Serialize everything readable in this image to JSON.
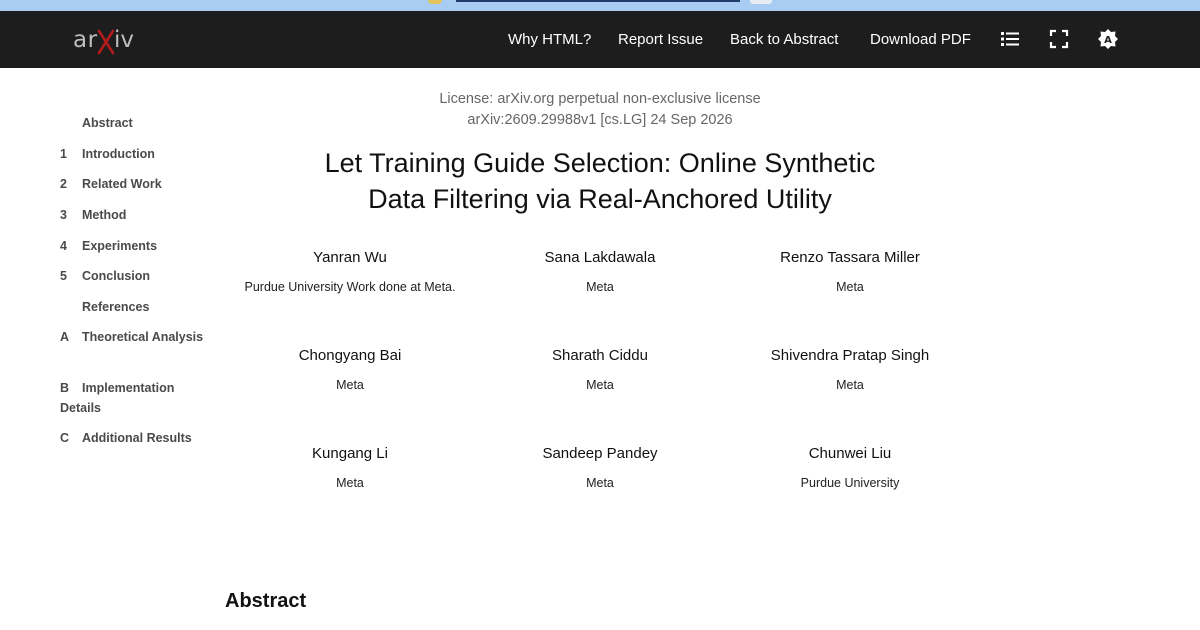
{
  "header": {
    "logo": "arXiv",
    "nav": [
      "Why HTML?",
      "Report Issue",
      "Back to Abstract",
      "Download PDF"
    ],
    "icons": [
      "list-icon",
      "fullscreen-icon",
      "theme-icon"
    ],
    "background_color": "#1d1d1d"
  },
  "toc": {
    "items": [
      {
        "num": "",
        "label": "Abstract"
      },
      {
        "num": "1",
        "label": "Introduction"
      },
      {
        "num": "2",
        "label": "Related Work"
      },
      {
        "num": "3",
        "label": "Method"
      },
      {
        "num": "4",
        "label": "Experiments"
      },
      {
        "num": "5",
        "label": "Conclusion"
      },
      {
        "num": "",
        "label": "References"
      },
      {
        "num": "A",
        "label": "Theoretical Analysis"
      },
      {
        "num": "B",
        "label": "Implementation Details"
      },
      {
        "num": "C",
        "label": "Additional Results"
      }
    ]
  },
  "paper": {
    "license": "License: arXiv.org perpetual non-exclusive license",
    "identifier": "arXiv:2609.29988v1 [cs.LG] 24 Sep 2026",
    "title_line1": "Let Training Guide Selection: Online Synthetic",
    "title_line2": "Data Filtering via Real-Anchored Utility",
    "authors": [
      {
        "name": "Yanran Wu",
        "affiliation": "Purdue University Work done at Meta."
      },
      {
        "name": "Sana Lakdawala",
        "affiliation": "Meta"
      },
      {
        "name": "Renzo Tassara Miller",
        "affiliation": "Meta"
      },
      {
        "name": "Chongyang Bai",
        "affiliation": "Meta"
      },
      {
        "name": "Sharath Ciddu",
        "affiliation": "Meta"
      },
      {
        "name": "Shivendra Pratap Singh",
        "affiliation": "Meta"
      },
      {
        "name": "Kungang Li",
        "affiliation": "Meta"
      },
      {
        "name": "Sandeep Pandey",
        "affiliation": "Meta"
      },
      {
        "name": "Chunwei Liu",
        "affiliation": "Purdue University"
      }
    ],
    "abstract_heading": "Abstract"
  }
}
